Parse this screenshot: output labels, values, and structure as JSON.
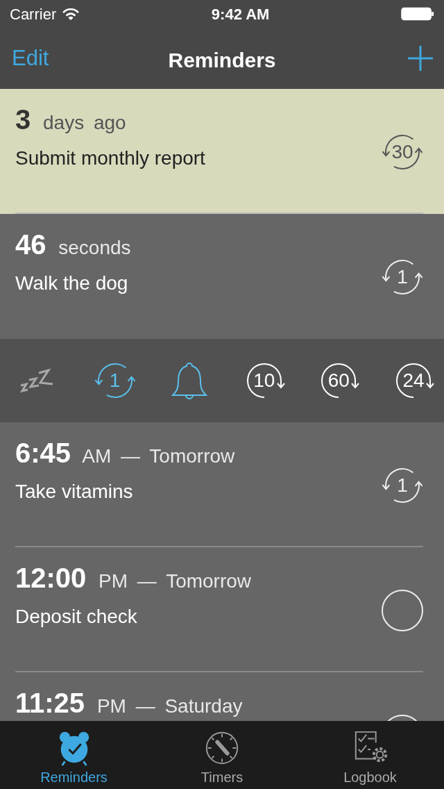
{
  "status_bar": {
    "carrier": "Carrier",
    "time": "9:42 AM"
  },
  "nav_bar": {
    "left": "Edit",
    "title": "Reminders"
  },
  "list": [
    {
      "kind": "reminder",
      "when": "**3** days ago",
      "title": "Submit monthly report",
      "selected": true,
      "icon": {
        "kind": "repeat",
        "label": "30"
      }
    },
    {
      "kind": "reminder",
      "when": "**46** seconds",
      "title": "Walk the dog",
      "selected": false,
      "icon": {
        "kind": "repeat",
        "label": "1"
      }
    },
    {
      "kind": "actions",
      "buttons": [
        {
          "kind": "snooze",
          "active": false,
          "disabled": true
        },
        {
          "kind": "repeat",
          "label": "1",
          "active": true,
          "disabled": false
        },
        {
          "kind": "alarm",
          "active": true,
          "disabled": false
        },
        {
          "kind": "delay",
          "label": "10",
          "active": false,
          "disabled": false
        },
        {
          "kind": "delay",
          "label": "60",
          "active": false,
          "disabled": false
        },
        {
          "kind": "delay",
          "label": "24",
          "active": false,
          "disabled": false
        }
      ]
    },
    {
      "kind": "reminder",
      "when": "**6:45** AM — Tomorrow",
      "title": "Take vitamins",
      "selected": false,
      "icon": {
        "kind": "repeat",
        "label": "1"
      }
    },
    {
      "kind": "reminder",
      "when": "**12:00** PM — Tomorrow",
      "title": "Deposit check",
      "selected": false,
      "icon": {
        "kind": "circle"
      }
    },
    {
      "kind": "reminder",
      "when": "**11:25** PM — Saturday",
      "selected": false,
      "icon": {
        "kind": "circle"
      }
    }
  ],
  "tab_bar": [
    {
      "kind": "alarm",
      "label": "Reminders",
      "selected": true
    },
    {
      "kind": "stopwatch",
      "label": "Timers",
      "selected": false
    },
    {
      "kind": "logbook",
      "label": "Logbook",
      "selected": false
    }
  ]
}
